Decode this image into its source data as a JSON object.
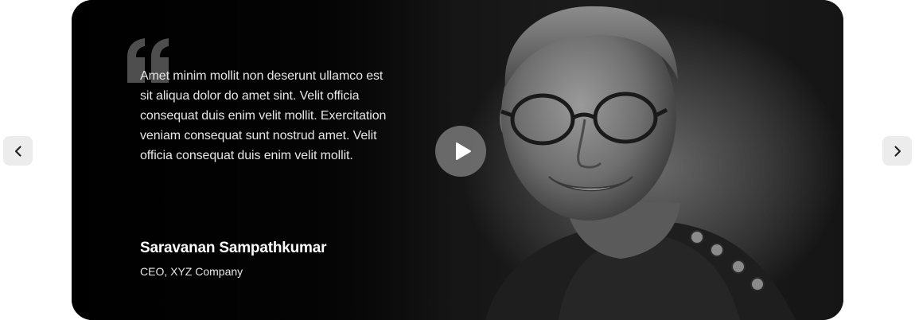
{
  "testimonial": {
    "quote": "Amet minim mollit non deserunt ullamco est sit aliqua dolor do amet sint. Velit officia consequat duis enim velit mollit. Exercitation veniam consequat sunt nostrud amet. Velit officia consequat duis enim velit mollit.",
    "author_name": "Saravanan Sampathkumar",
    "author_role": "CEO, XYZ Company"
  },
  "icons": {
    "prev": "chevron-left-icon",
    "next": "chevron-right-icon",
    "play": "play-icon",
    "quote": "quote-icon"
  },
  "colors": {
    "card_background": "#141414",
    "nav_button": "#ececec",
    "play_button": "#787878",
    "text": "#e6e6e6"
  }
}
